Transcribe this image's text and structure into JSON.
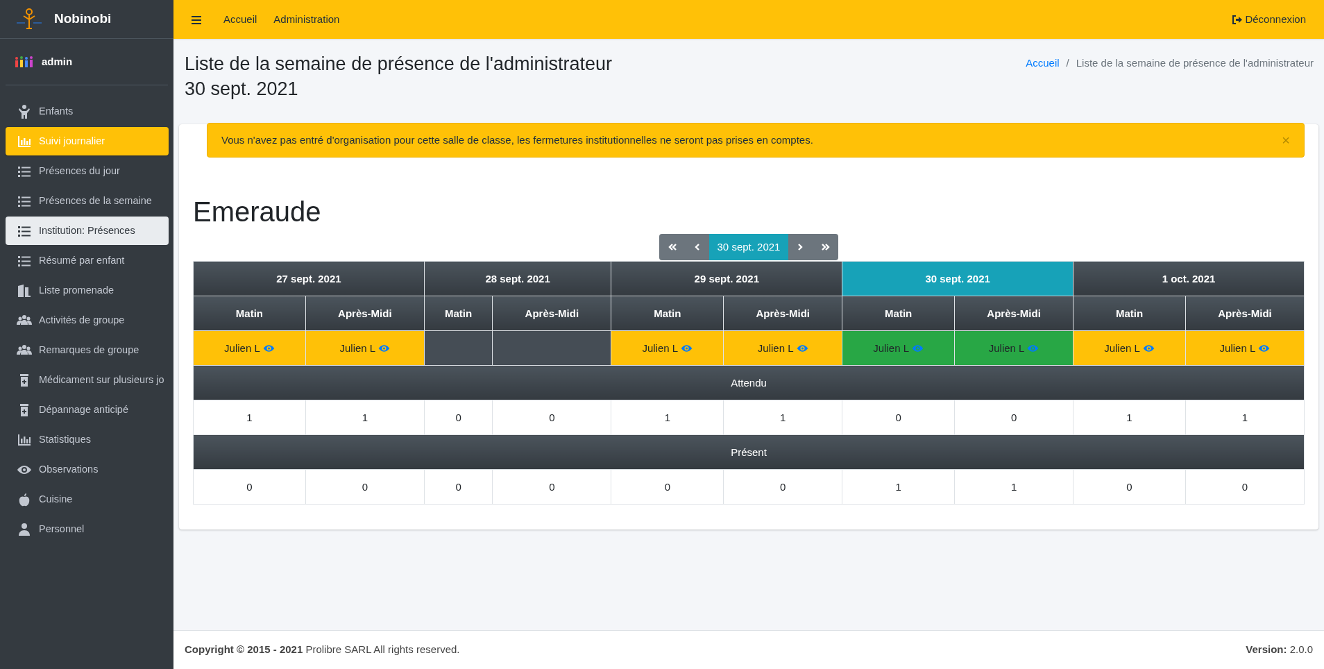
{
  "brand": {
    "name": "Nobinobi"
  },
  "user": {
    "name": "admin"
  },
  "sidebar": {
    "items": [
      {
        "label": "Enfants",
        "kind": "child",
        "selected": false,
        "highlighted": false
      },
      {
        "label": "Suivi journalier",
        "kind": "chart",
        "selected": true,
        "highlighted": false
      },
      {
        "label": "Présences du jour",
        "kind": "list",
        "selected": false,
        "highlighted": false
      },
      {
        "label": "Présences de la semaine",
        "kind": "list",
        "selected": false,
        "highlighted": false
      },
      {
        "label": "Institution: Présences",
        "kind": "list",
        "selected": false,
        "highlighted": true
      },
      {
        "label": "Résumé par enfant",
        "kind": "list",
        "selected": false,
        "highlighted": false
      },
      {
        "label": "Liste promenade",
        "kind": "door",
        "selected": false,
        "highlighted": false
      },
      {
        "label": "Activités de groupe",
        "kind": "users",
        "selected": false,
        "highlighted": false
      },
      {
        "label": "Remarques de groupe",
        "kind": "users",
        "selected": false,
        "highlighted": false
      },
      {
        "label": "Médicament sur plusieurs jo",
        "kind": "medicine",
        "selected": false,
        "highlighted": false
      },
      {
        "label": "Dépannage anticipé",
        "kind": "medicine",
        "selected": false,
        "highlighted": false
      },
      {
        "label": "Statistiques",
        "kind": "chart",
        "selected": false,
        "highlighted": false
      },
      {
        "label": "Observations",
        "kind": "eye",
        "selected": false,
        "highlighted": false
      },
      {
        "label": "Cuisine",
        "kind": "apple",
        "selected": false,
        "highlighted": false
      },
      {
        "label": "Personnel",
        "kind": "person",
        "selected": false,
        "highlighted": false
      }
    ]
  },
  "topbar": {
    "links": [
      "Accueil",
      "Administration"
    ],
    "logout": "Déconnexion"
  },
  "page": {
    "title": "Liste de la semaine de présence de l'administrateur",
    "date": "30 sept. 2021",
    "breadcrumb": [
      "Accueil",
      "Liste de la semaine de présence de l'administrateur"
    ],
    "breadcrumb_separator": "/"
  },
  "alert": {
    "text": "Vous n'avez pas entré d'organisation pour cette salle de classe, les fermetures institutionnelles ne seront pas prises en comptes.",
    "close": "×"
  },
  "classroom": {
    "name": "Emeraude"
  },
  "pager": {
    "date": "30 sept. 2021"
  },
  "week": {
    "days": [
      {
        "date": "27 sept. 2021",
        "selected": false,
        "slots": [
          {
            "label": "Matin",
            "color": "#ffc107",
            "child": "Julien L",
            "attendu": "1",
            "present": "0"
          },
          {
            "label": "Après-Midi",
            "color": "#ffc107",
            "child": "Julien L",
            "attendu": "1",
            "present": "0"
          }
        ]
      },
      {
        "date": "28 sept. 2021",
        "selected": false,
        "slots": [
          {
            "label": "Matin",
            "color": "#454d55",
            "attendu": "0",
            "present": "0"
          },
          {
            "label": "Après-Midi",
            "color": "#454d55",
            "attendu": "0",
            "present": "0"
          }
        ]
      },
      {
        "date": "29 sept. 2021",
        "selected": false,
        "slots": [
          {
            "label": "Matin",
            "color": "#ffc107",
            "child": "Julien L",
            "attendu": "1",
            "present": "0"
          },
          {
            "label": "Après-Midi",
            "color": "#ffc107",
            "child": "Julien L",
            "attendu": "1",
            "present": "0"
          }
        ]
      },
      {
        "date": "30 sept. 2021",
        "selected": true,
        "slots": [
          {
            "label": "Matin",
            "color": "#28a745",
            "child": "Julien L",
            "attendu": "0",
            "present": "1"
          },
          {
            "label": "Après-Midi",
            "color": "#28a745",
            "child": "Julien L",
            "attendu": "0",
            "present": "1"
          }
        ]
      },
      {
        "date": "1 oct. 2021",
        "selected": false,
        "slots": [
          {
            "label": "Matin",
            "color": "#ffc107",
            "child": "Julien L",
            "attendu": "1",
            "present": "0"
          },
          {
            "label": "Après-Midi",
            "color": "#ffc107",
            "child": "Julien L",
            "attendu": "1",
            "present": "0"
          }
        ]
      }
    ],
    "attendu_label": "Attendu",
    "present_label": "Présent"
  },
  "footer": {
    "copyright": "Copyright © 2015 - 2021",
    "company": "Prolibre SARL All rights reserved.",
    "version_label": "Version:",
    "version": "2.0.0"
  }
}
